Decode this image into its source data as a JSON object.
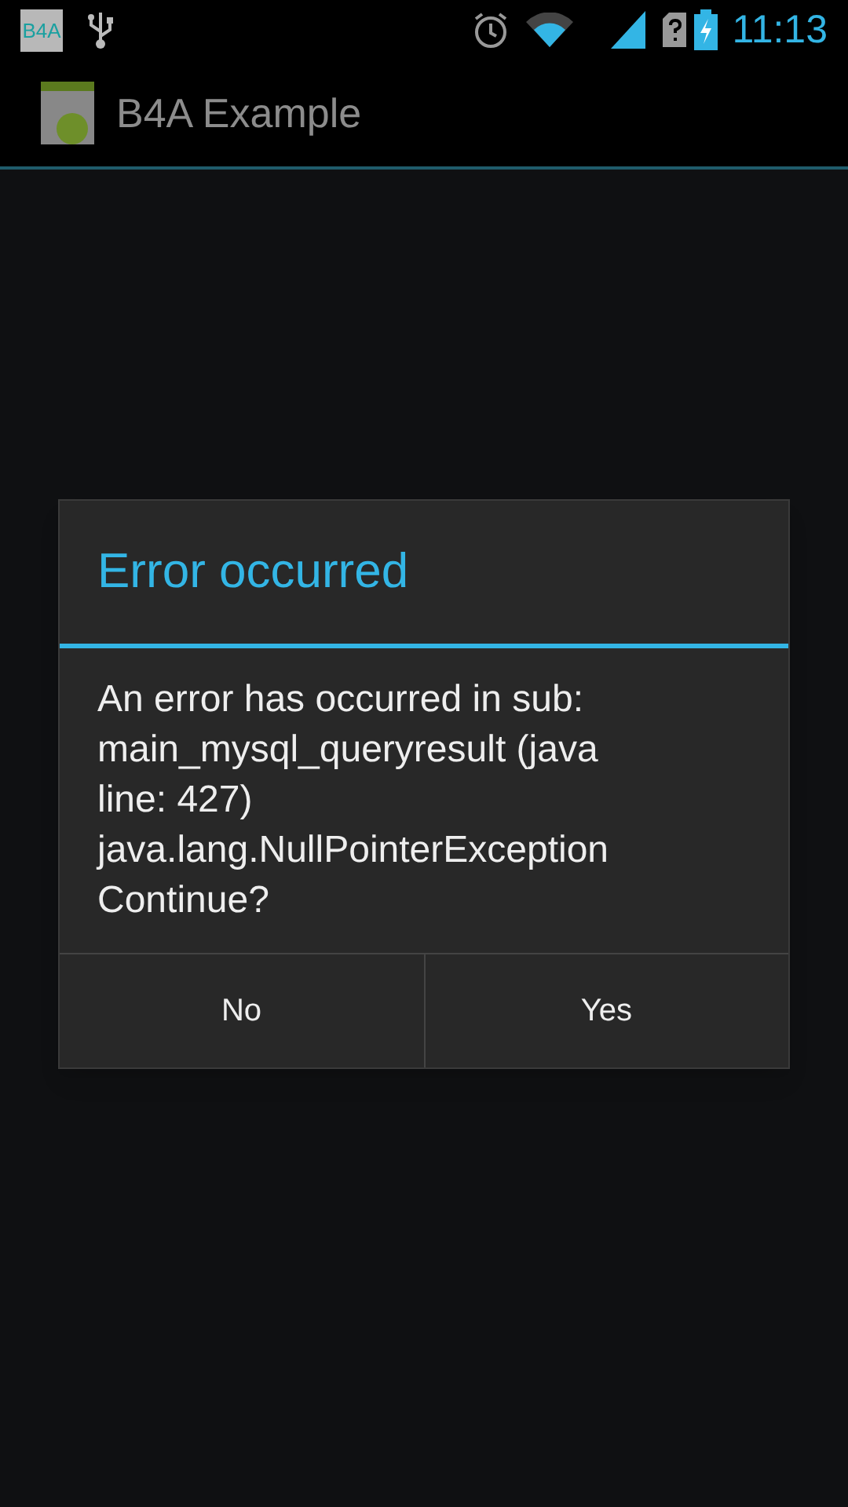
{
  "status_bar": {
    "notification_logo": "B4A",
    "time": "11:13"
  },
  "action_bar": {
    "title": "B4A Example"
  },
  "dialog": {
    "title": "Error occurred",
    "message": "An error has occurred in sub:\nmain_mysql_queryresult (java\nline: 427)\njava.lang.NullPointerException\nContinue?",
    "buttons": [
      "No",
      "Yes"
    ]
  }
}
